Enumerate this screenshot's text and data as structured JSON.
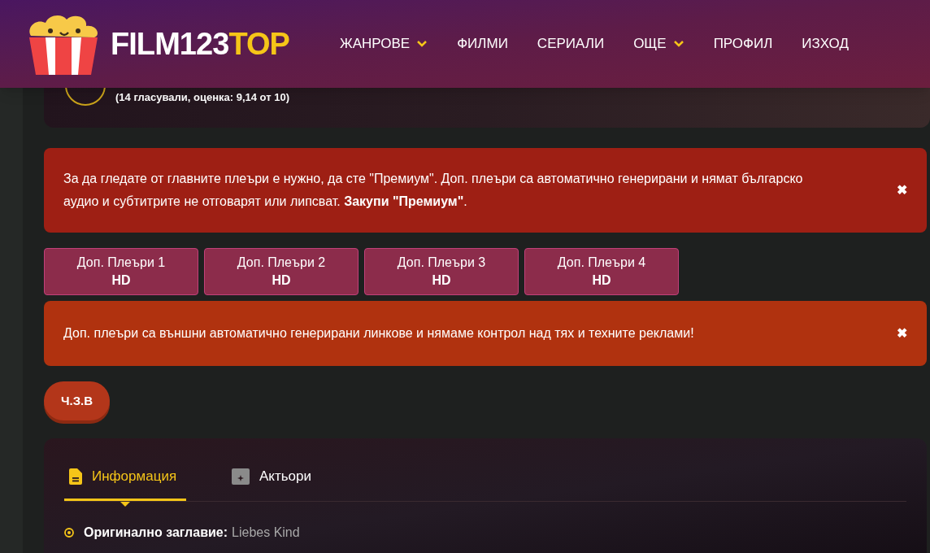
{
  "header": {
    "logo": {
      "main": "FILM123",
      "accent": "TOP"
    },
    "nav": [
      {
        "label": "ЖАНРОВЕ",
        "has_menu": true
      },
      {
        "label": "ФИЛМИ",
        "has_menu": false
      },
      {
        "label": "СЕРИАЛИ",
        "has_menu": false
      },
      {
        "label": "ОЩЕ",
        "has_menu": true
      },
      {
        "label": "ПРОФИЛ",
        "has_menu": false
      },
      {
        "label": "ИЗХОД",
        "has_menu": false
      }
    ]
  },
  "rating": {
    "votes": "(14 гласували, оценка: 9,14 от 10)"
  },
  "alerts": [
    {
      "kind": "premium",
      "text": "За да гледате от главните плеъри е нужно, да сте \"Премиум\". Доп. плеъри са автоматично генерирани и нямат българско аудио и субтитрите не отговарят или липсват. **Закупи \"Премиум\"**.",
      "close": "✖"
    }
  ],
  "players": [
    {
      "label": "Доп. Плеъри 1",
      "quality": "HD"
    },
    {
      "label": "Доп. Плеъри 2",
      "quality": "HD"
    },
    {
      "label": "Доп. Плеъри 3",
      "quality": "HD"
    },
    {
      "label": "Доп. Плеъри 4",
      "quality": "HD"
    }
  ],
  "warning": {
    "kind": "warning",
    "text": "Доп. плеъри са външни автоматично генерирани линкове и нямаме контрол над тях и техните реклами!",
    "close": "✖"
  },
  "faq_button": "Ч.З.В",
  "info": {
    "tabs": [
      {
        "label": "Информация",
        "kind": "info",
        "selected": true
      },
      {
        "label": "Актьори",
        "kind": "cast",
        "selected": false
      }
    ],
    "fields": [
      {
        "label": "Оригинално заглавие:",
        "value": "Liebes Kind"
      }
    ]
  }
}
